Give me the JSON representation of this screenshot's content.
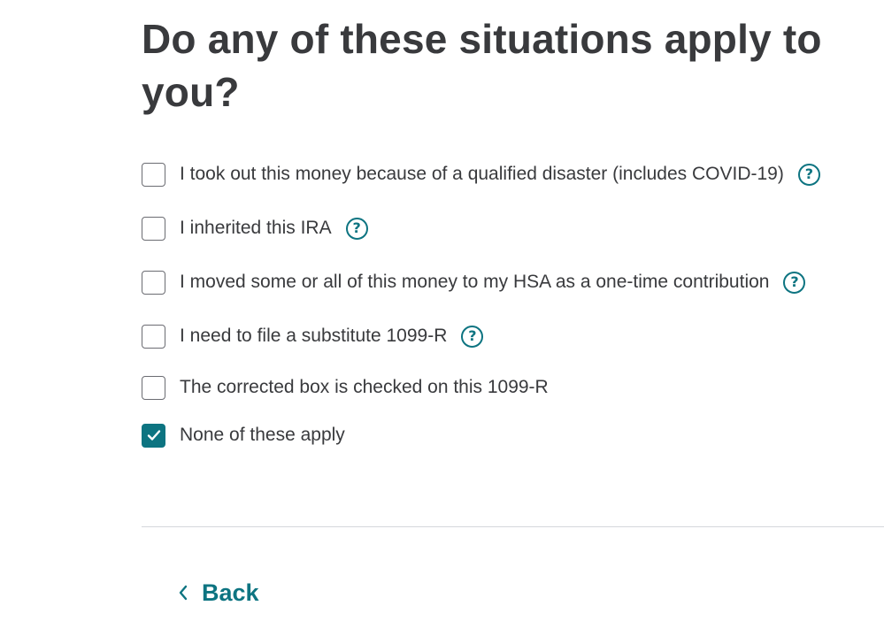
{
  "page": {
    "title": "Do any of these situations apply to you?"
  },
  "options": [
    {
      "label": "I took out this money because of a qualified disaster (includes COVID-19)",
      "checked": false,
      "has_help": true
    },
    {
      "label": "I inherited this IRA",
      "checked": false,
      "has_help": true
    },
    {
      "label": "I moved some or all of this money to my HSA as a one-time contribution",
      "checked": false,
      "has_help": true
    },
    {
      "label": "I need to file a substitute 1099-R",
      "checked": false,
      "has_help": true
    },
    {
      "label": "The corrected box is checked on this 1099-R",
      "checked": false,
      "has_help": false
    },
    {
      "label": "None of these apply",
      "checked": true,
      "has_help": false
    }
  ],
  "help_icon_glyph": "?",
  "nav": {
    "back_label": "Back"
  },
  "colors": {
    "accent": "#0d7481",
    "text": "#393a3d",
    "checkbox_border": "#6b6c72",
    "divider": "#d4d7dc"
  }
}
